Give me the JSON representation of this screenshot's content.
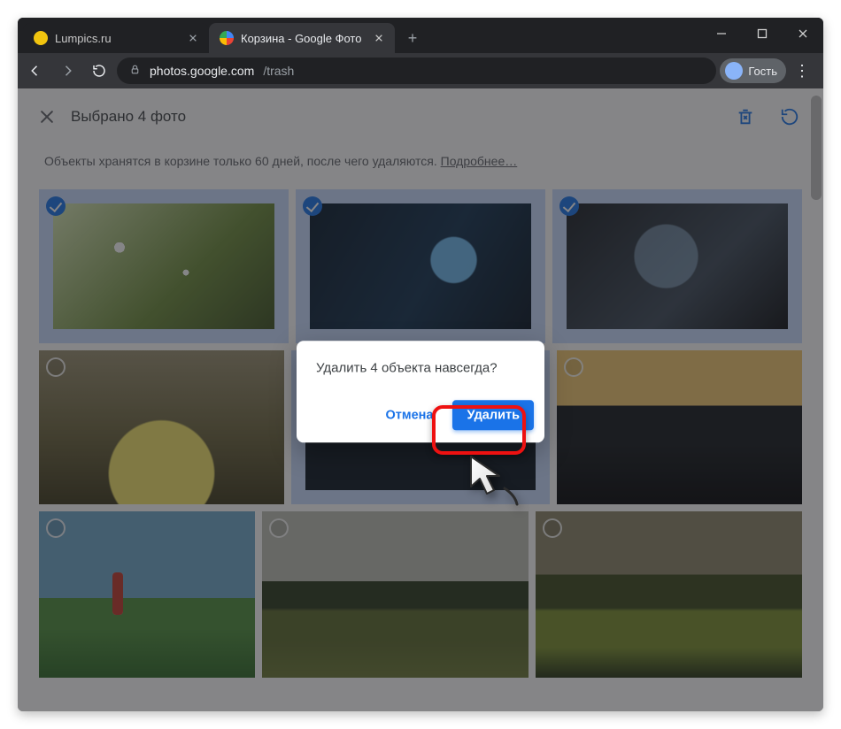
{
  "window": {
    "minimize": "",
    "maximize": "",
    "close": ""
  },
  "tabs": [
    {
      "title": "Lumpics.ru",
      "active": false
    },
    {
      "title": "Корзина - Google Фото",
      "active": true
    }
  ],
  "omnibox": {
    "host": "photos.google.com",
    "path": "/trash"
  },
  "profile": {
    "label": "Гость"
  },
  "selection_header": {
    "title": "Выбрано 4 фото"
  },
  "info_banner": {
    "text": "Объекты хранятся в корзине только 60 дней, после чего удаляются.  ",
    "link": "Подробнее…"
  },
  "grid": {
    "rows": [
      {
        "thumbs": [
          {
            "id": "a",
            "selected": true
          },
          {
            "id": "b",
            "selected": true
          },
          {
            "id": "c",
            "selected": true
          }
        ]
      },
      {
        "thumbs": [
          {
            "id": "d",
            "selected": false
          },
          {
            "id": "e",
            "selected": true
          },
          {
            "id": "f",
            "selected": false
          }
        ]
      },
      {
        "thumbs": [
          {
            "id": "g",
            "selected": false
          },
          {
            "id": "h",
            "selected": false
          },
          {
            "id": "i",
            "selected": false
          }
        ]
      }
    ]
  },
  "dialog": {
    "title": "Удалить 4 объекта навсегда?",
    "cancel": "Отмена",
    "confirm": "Удалить"
  }
}
